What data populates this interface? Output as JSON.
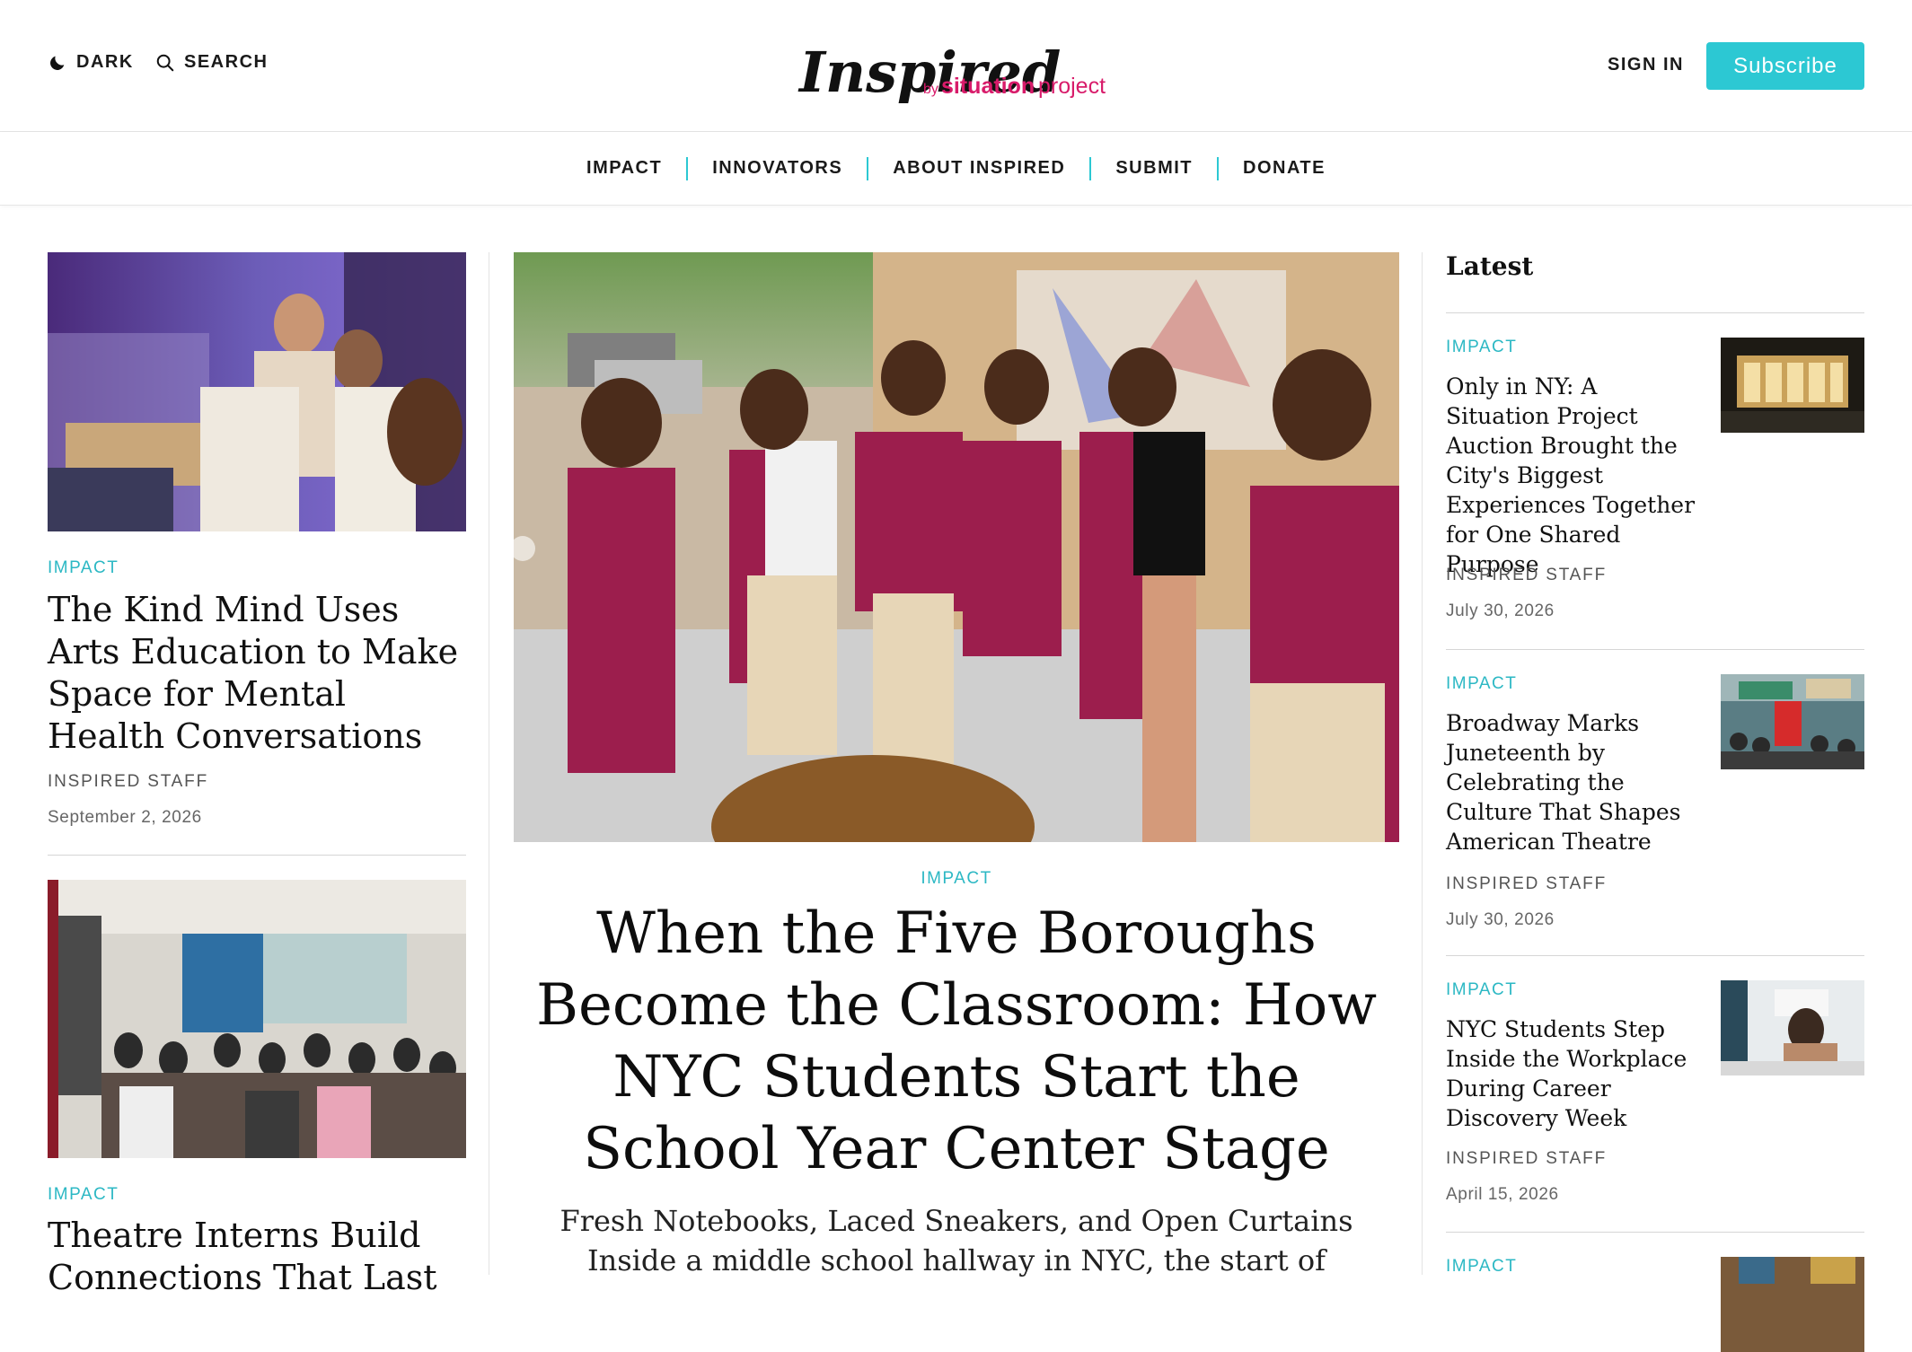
{
  "header": {
    "dark_label": "DARK",
    "search_label": "SEARCH",
    "logo_main": "Inspired",
    "logo_by": "by",
    "logo_situation": "situation",
    "logo_project": "project",
    "signin_label": "SIGN IN",
    "subscribe_label": "Subscribe"
  },
  "nav": {
    "items": [
      "IMPACT",
      "INNOVATORS",
      "ABOUT INSPIRED",
      "SUBMIT",
      "DONATE"
    ]
  },
  "left": {
    "articles": [
      {
        "kicker": "IMPACT",
        "title": "The Kind Mind Uses Arts Education to Make Space for Mental Health Conversations",
        "author": "INSPIRED STAFF",
        "date": "September 2, 2026"
      },
      {
        "kicker": "IMPACT",
        "title": "Theatre Interns Build Connections That Last"
      }
    ]
  },
  "featured": {
    "kicker": "IMPACT",
    "title": "When the Five Boroughs Become the Classroom: How NYC Students Start the School Year Center Stage",
    "subtitle_line1": "Fresh Notebooks, Laced Sneakers, and Open Curtains",
    "subtitle_line2": "Inside a middle school hallway in NYC, the start of"
  },
  "latest": {
    "heading": "Latest",
    "items": [
      {
        "kicker": "IMPACT",
        "title": "Only in NY: A Situation Project Auction Brought the City's Biggest Experiences Together for One Shared Purpose",
        "author": "INSPIRED STAFF",
        "date": "July 30, 2026"
      },
      {
        "kicker": "IMPACT",
        "title": "Broadway Marks Juneteenth by Celebrating the Culture That Shapes American Theatre",
        "author": "INSPIRED STAFF",
        "date": "July 30, 2026"
      },
      {
        "kicker": "IMPACT",
        "title": "NYC Students Step Inside the Workplace During Career Discovery Week",
        "author": "INSPIRED STAFF",
        "date": "April 15, 2026"
      },
      {
        "kicker": "IMPACT"
      }
    ]
  },
  "colors": {
    "accent": "#2cc8d3",
    "logo_pink": "#d81b6a",
    "logo_black": "#111111"
  },
  "icons": [
    "moon-icon",
    "search-icon"
  ]
}
